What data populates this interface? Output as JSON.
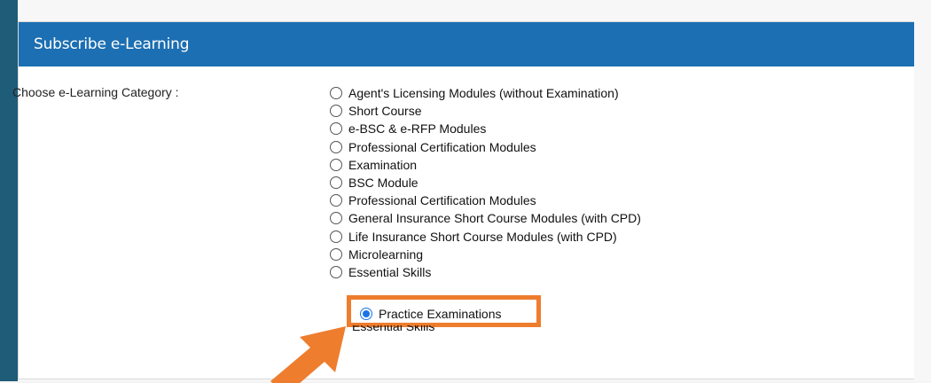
{
  "panel": {
    "title": "Subscribe e-Learning"
  },
  "form": {
    "label": "Choose e-Learning Category :",
    "options": [
      {
        "label": "Agent's Licensing Modules (without Examination)",
        "checked": false
      },
      {
        "label": "Short Course",
        "checked": false
      },
      {
        "label": "e-BSC & e-RFP Modules",
        "checked": false
      },
      {
        "label": "Professional Certification Modules",
        "checked": false
      },
      {
        "label": "Examination",
        "checked": false
      },
      {
        "label": "BSC Module",
        "checked": false
      },
      {
        "label": "Professional Certification Modules",
        "checked": false
      },
      {
        "label": "General Insurance Short Course Modules (with CPD)",
        "checked": false
      },
      {
        "label": "Life Insurance Short Course Modules (with CPD)",
        "checked": false
      },
      {
        "label": "Microlearning",
        "checked": false
      },
      {
        "label": "Essential Skills",
        "checked": false
      }
    ],
    "selected": {
      "label": "Practice Examinations",
      "checked": true
    },
    "below_peek": "Essential Skills"
  },
  "colors": {
    "header_bg": "#1c6fb2",
    "highlight": "#ee7d2e",
    "left_strip": "#1f5c78"
  }
}
